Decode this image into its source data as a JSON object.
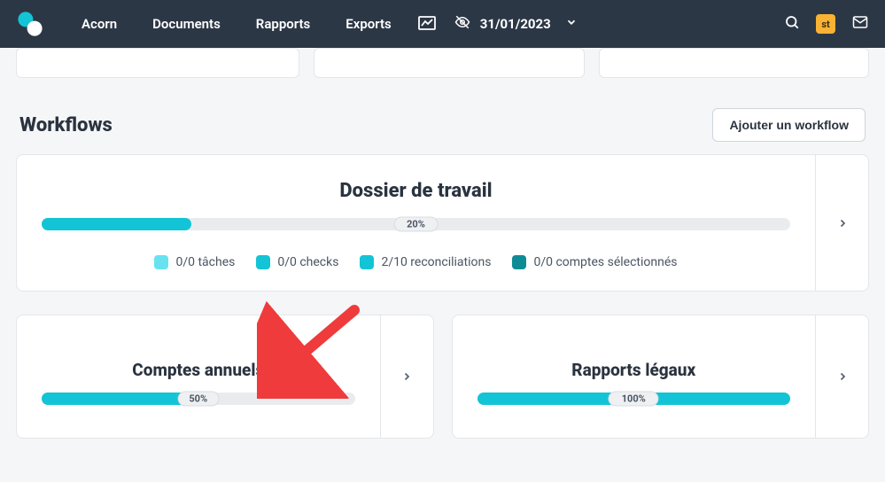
{
  "nav": {
    "items": [
      "Acorn",
      "Documents",
      "Rapports",
      "Exports"
    ],
    "date": "31/01/2023"
  },
  "section": {
    "title": "Workflows",
    "add_button": "Ajouter un workflow"
  },
  "workflows": {
    "main": {
      "title": "Dossier de travail",
      "progress_pct": 20,
      "progress_label": "20%",
      "legend": [
        {
          "label": "0/0 tâches"
        },
        {
          "label": "0/0 checks"
        },
        {
          "label": "2/10 reconciliations"
        },
        {
          "label": "0/0 comptes sélectionnés"
        }
      ]
    },
    "cards": [
      {
        "title": "Comptes annuels",
        "progress_pct": 50,
        "progress_label": "50%"
      },
      {
        "title": "Rapports légaux",
        "progress_pct": 100,
        "progress_label": "100%"
      }
    ]
  },
  "badge": "st"
}
